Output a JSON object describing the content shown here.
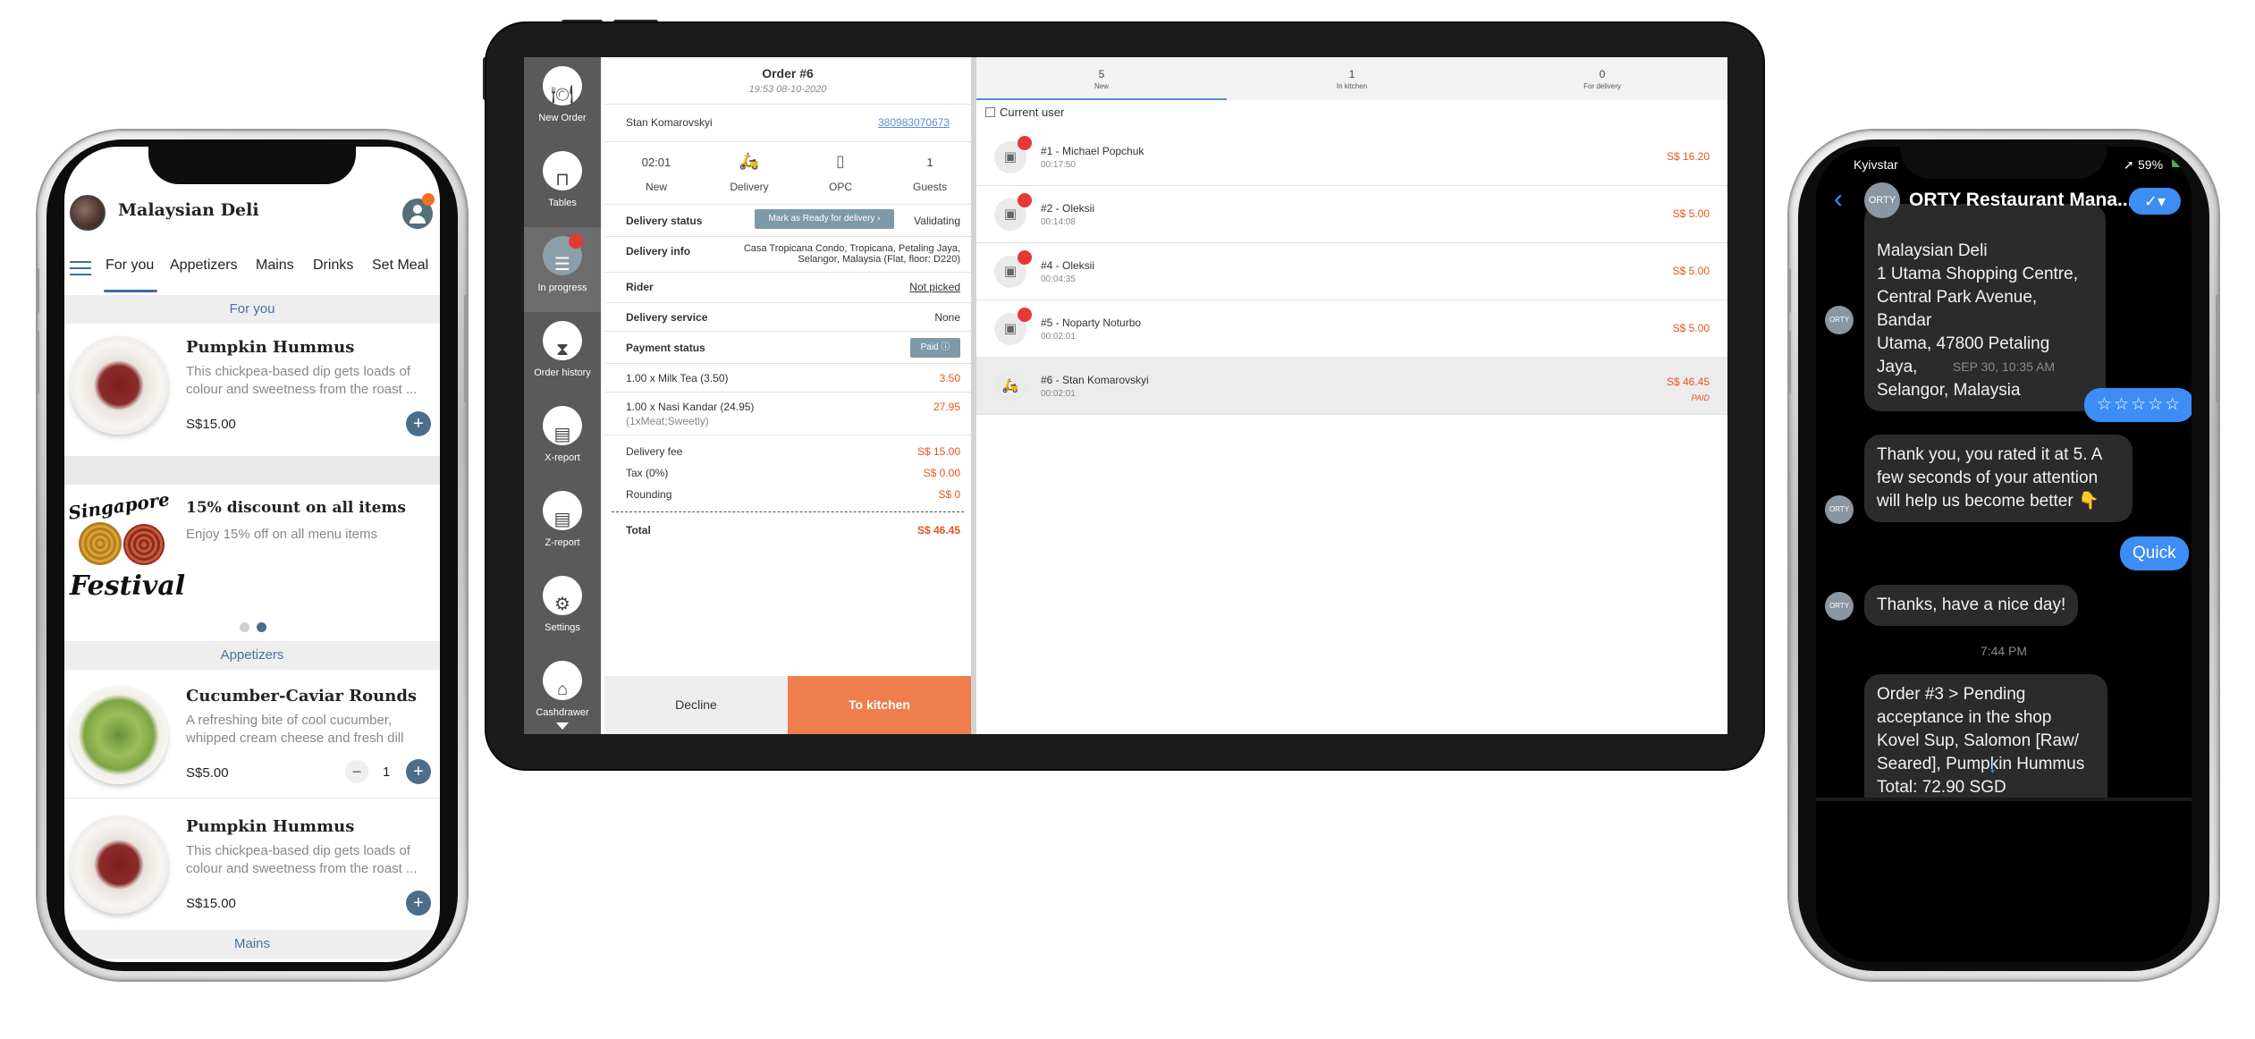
{
  "left_phone": {
    "restaurant_name": "Malaysian Deli",
    "tabs": [
      "For you",
      "Appetizers",
      "Mains",
      "Drinks",
      "Set Meal"
    ],
    "sections": {
      "for_you": "For you",
      "appetizers": "Appetizers",
      "mains": "Mains"
    },
    "items": [
      {
        "title": "Pumpkin Hummus",
        "desc_line1": "This chickpea-based dip gets loads of",
        "desc_line2": "colour and sweetness from the roast ...",
        "price": "S$15.00"
      },
      {
        "title": "Cucumber-Caviar Rounds",
        "desc_line1": "A refreshing bite of cool cucumber,",
        "desc_line2": "whipped cream cheese and fresh dill",
        "price": "S$5.00",
        "qty": "1"
      },
      {
        "title": "Pumpkin Hummus",
        "desc_line1": "This chickpea-based dip gets loads of",
        "desc_line2": "colour and sweetness from the roast ...",
        "price": "S$15.00"
      }
    ],
    "promo": {
      "title": "15% discount on all items",
      "desc": "Enjoy 15% off on all menu items",
      "image_top": "Singapore",
      "image_bottom": "Festival"
    },
    "carousel": {
      "pages": 2,
      "active": 2
    }
  },
  "tablet": {
    "nav": [
      {
        "label": "New Order",
        "icon": "dish-icon"
      },
      {
        "label": "Tables",
        "icon": "table-icon"
      },
      {
        "label": "In progress",
        "icon": "list-icon"
      },
      {
        "label": "Order history",
        "icon": "history-icon"
      },
      {
        "label": "X-report",
        "icon": "receipt-icon"
      },
      {
        "label": "Z-report",
        "icon": "receipt-icon"
      },
      {
        "label": "Settings",
        "icon": "gears-icon"
      },
      {
        "label": "Cashdrawer",
        "icon": "register-icon"
      }
    ],
    "order": {
      "title": "Order #6",
      "datetime": "19:53 08-10-2020",
      "customer": "Stan Komarovskyi",
      "phone": "380983070673",
      "stats": [
        {
          "value": "02:01",
          "label": "New"
        },
        {
          "value": "",
          "label": "Delivery",
          "icon": "scooter-icon"
        },
        {
          "value": "",
          "label": "OPC",
          "icon": "phone-icon"
        },
        {
          "value": "1",
          "label": "Guests"
        }
      ],
      "delivery_status_label": "Delivery status",
      "mark_ready_button": "Mark as Ready for delivery",
      "delivery_status_value": "Validating",
      "delivery_info_label": "Delivery info",
      "delivery_info_line1": "Casa Tropicana Condo, Tropicana, Petaling Jaya,",
      "delivery_info_line2": "Selangor, Malaysia (Flat, floor: D220)",
      "rider_label": "Rider",
      "rider_value": "Not picked",
      "delivery_service_label": "Delivery service",
      "delivery_service_value": "None",
      "payment_status_label": "Payment status",
      "payment_badge": "Paid",
      "lines": [
        {
          "name": "1.00 x Milk Tea (3.50)",
          "amount": "3.50"
        },
        {
          "name": "1.00 x Nasi Kandar (24.95)",
          "sub": "(1xMeat;Sweetly)",
          "amount": "27.95"
        }
      ],
      "delivery_fee_label": "Delivery fee",
      "delivery_fee": "S$ 15.00",
      "tax_label": "Tax (0%)",
      "tax": "S$ 0.00",
      "rounding_label": "Rounding",
      "rounding": "S$ 0",
      "total_label": "Total",
      "total": "S$ 46.45",
      "decline_button": "Decline",
      "kitchen_button": "To kitchen"
    },
    "tabs": [
      {
        "count": "5",
        "label": "New"
      },
      {
        "count": "1",
        "label": "In kitchen"
      },
      {
        "count": "0",
        "label": "For delivery"
      }
    ],
    "current_user_label": "Current user",
    "orders": [
      {
        "name": "#1 - Michael Popchuk",
        "time": "00:17:50",
        "price": "S$ 16.20"
      },
      {
        "name": "#2 - Oleksii",
        "time": "00:14:08",
        "price": "S$ 5.00"
      },
      {
        "name": "#4 - Oleksii",
        "time": "00:04:35",
        "price": "S$ 5.00"
      },
      {
        "name": "#5 - Noparty Noturbo",
        "time": "00:02:01",
        "price": "S$ 5.00"
      },
      {
        "name": "#6 - Stan Komarovskyi",
        "time": "00:02:01",
        "price": "S$ 46.45",
        "paid": "PAID"
      }
    ]
  },
  "right_phone": {
    "carrier": "Kyivstar",
    "battery": "59%",
    "chat_title": "ORTY Restaurant Mana...",
    "avatar_text": "ORTY",
    "messages": [
      {
        "side": "in",
        "lines": [
          "Malaysian Deli",
          "1 Utama Shopping Centre,",
          "Central Park Avenue, Bandar",
          "Utama, 47800 Petaling Jaya,",
          "Selangor, Malaysia"
        ]
      },
      {
        "side": "sep",
        "text": "SEP 30, 10:35 AM"
      },
      {
        "side": "out",
        "text": "☆☆☆☆☆"
      },
      {
        "side": "in",
        "lines": [
          "Thank you, you rated it at 5. A",
          "few seconds of your attention",
          "will help us become better 👇"
        ]
      },
      {
        "side": "out",
        "text": "Quick"
      },
      {
        "side": "in",
        "lines": [
          "Thanks, have a nice day!"
        ]
      },
      {
        "side": "sep",
        "text": "7:44 PM"
      },
      {
        "side": "in",
        "lines": [
          "Order #3 > Pending",
          "acceptance in the shop",
          "Kovel Sup, Salomon [Raw/",
          "Seared], Pumpkin Hummus",
          "Total: 72.90 SGD"
        ]
      }
    ]
  },
  "colors": {
    "accent_blue": "#3d8df5",
    "orange": "#ef7e4d",
    "price_orange": "#e8541e",
    "sidebar": "#5a5a5a"
  }
}
